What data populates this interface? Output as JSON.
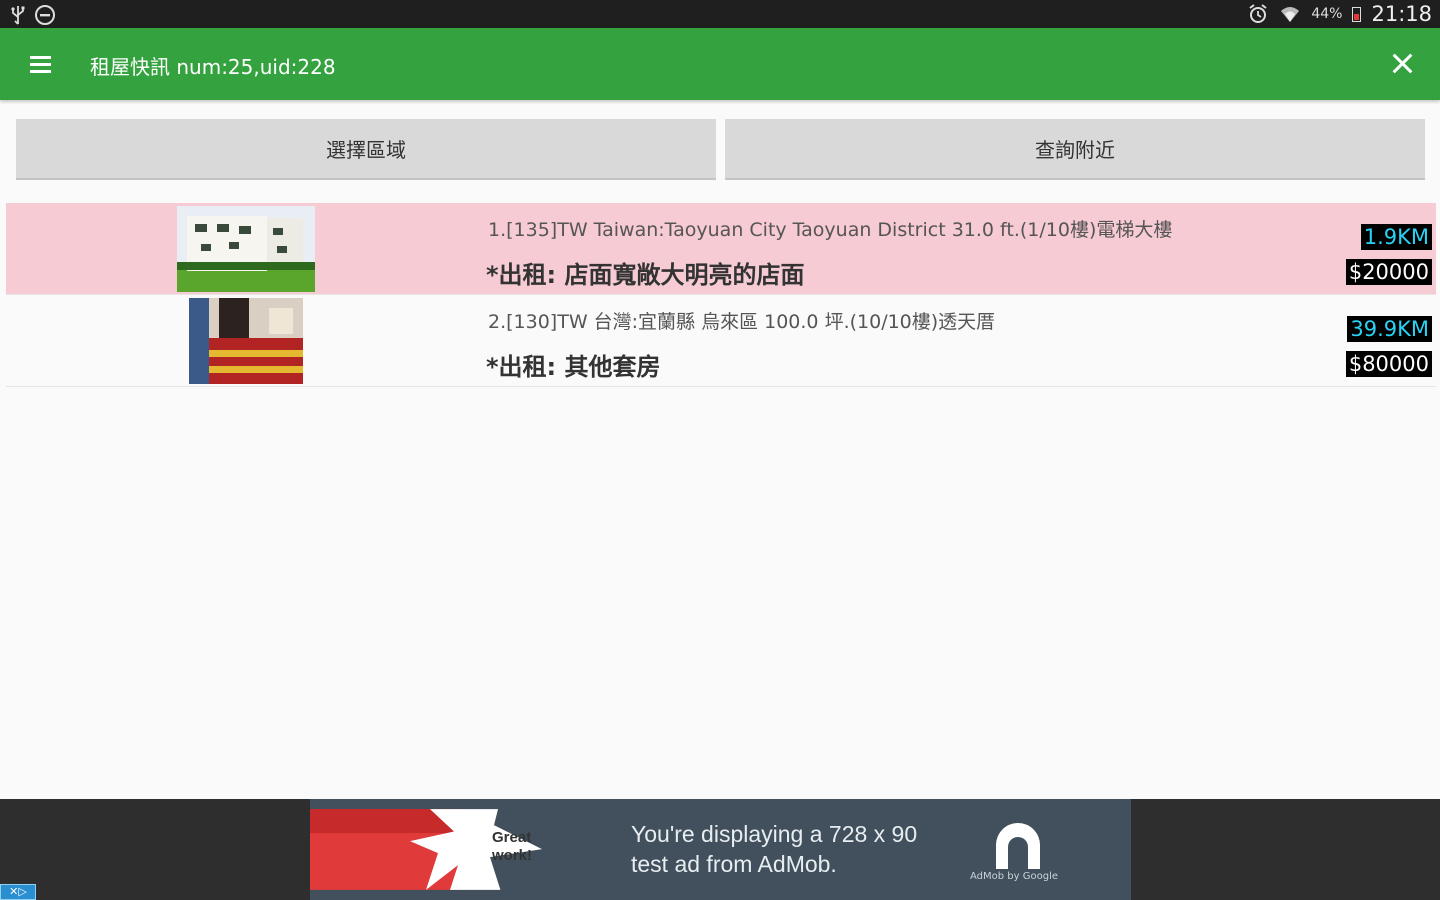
{
  "status_bar": {
    "battery_percent": "44%",
    "time": "21:18",
    "icons": [
      "usb-icon",
      "do-not-disturb-icon",
      "alarm-icon",
      "wifi-icon",
      "battery-icon"
    ]
  },
  "app_bar": {
    "title": "租屋快訊 num:25,uid:228",
    "color": "#34a33f"
  },
  "actions": {
    "select_area_label": "選擇區域",
    "search_nearby_label": "查詢附近"
  },
  "listings": [
    {
      "title": "1.[135]TW Taiwan:Taoyuan City Taoyuan District 31.0 ft.(1/10樓)電梯大樓",
      "subtitle": "*出租: 店面寬敞大明亮的店面",
      "distance": "1.9KM",
      "price": "$20000",
      "selected": true
    },
    {
      "title": "2.[130]TW 台灣:宜蘭縣 烏來區 100.0 坪.(10/10樓)透天厝",
      "subtitle": "*出租: 其他套房",
      "distance": "39.9KM",
      "price": "$80000",
      "selected": false
    }
  ],
  "ad": {
    "badge_text": "Great work!",
    "line1": "You're displaying a 728 x 90",
    "line2": "test ad from AdMob.",
    "brand": "AdMob by Google"
  }
}
